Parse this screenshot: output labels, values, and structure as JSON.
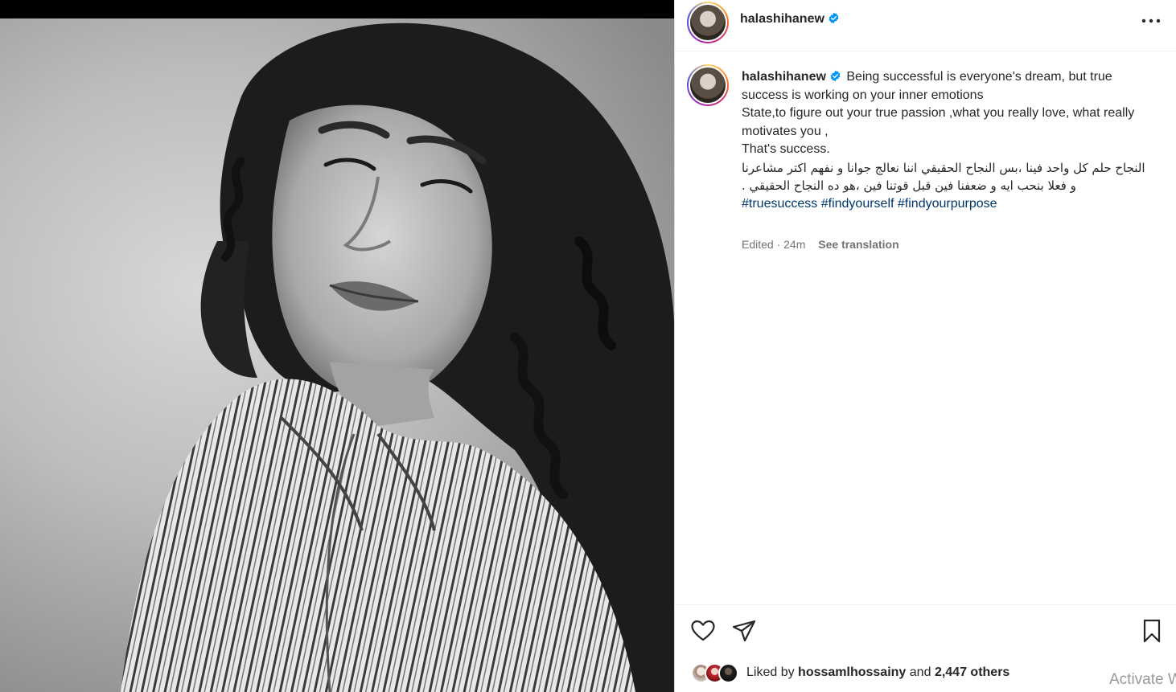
{
  "post": {
    "username": "halashihanew",
    "verified": true,
    "caption_lines": [
      "Being successful is everyone's dream, but true success is working on your inner emotions",
      "State,to figure out your true passion ,what you really love, what really motivates you ,",
      "That's success."
    ],
    "caption_arabic": "النجاح حلم كل واحد فينا ،بس النجاح الحقيقي اننا نعالج جوانا و نفهم اكتر مشاعرنا و فعلا بنحب ايه و ضعفنا فين قبل قوتنا فين ،هو ده النجاح الحقيقي .",
    "hashtags": [
      "#truesuccess",
      "#findyourself",
      "#findyourpurpose"
    ],
    "edited_label": "Edited · 24m",
    "see_translation": "See translation"
  },
  "likes": {
    "prefix": "Liked by",
    "user": "hossamlhossainy",
    "conjunction": "and",
    "others": "2,447 others"
  },
  "watermark": "Activate Windows",
  "colors": {
    "link": "#00376b",
    "verified": "#0095f6",
    "muted": "#737373",
    "text": "#262626"
  },
  "icons": [
    "more-options-icon",
    "heart-icon",
    "share-icon",
    "bookmark-icon",
    "verified-badge-icon"
  ]
}
